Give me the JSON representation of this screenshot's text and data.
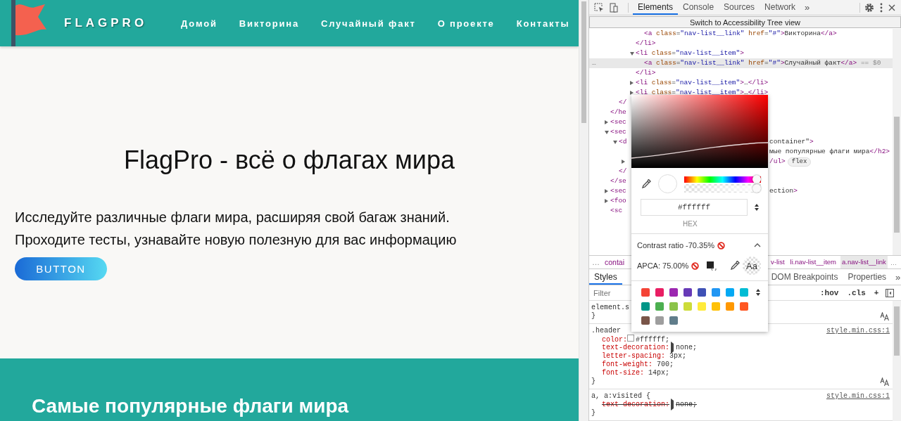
{
  "page": {
    "logo_text": "FLAGPRO",
    "nav": [
      {
        "label": "Домой"
      },
      {
        "label": "Викторина"
      },
      {
        "label": "Случайный факт"
      },
      {
        "label": "О проекте"
      },
      {
        "label": "Контакты"
      }
    ],
    "hero": {
      "title": "FlagPro - всё о флагах мира",
      "lines": [
        "Исследуйте различные флаги мира, расширяя свой багаж знаний.",
        "Проходите тесты, узнавайте новую полезную для вас информацию"
      ],
      "button": "BUTTON"
    },
    "section_title": "Самые популярные флаги мира"
  },
  "devtools": {
    "tabs": [
      {
        "label": "Elements",
        "selected": true
      },
      {
        "label": "Console",
        "selected": false
      },
      {
        "label": "Sources",
        "selected": false
      },
      {
        "label": "Network",
        "selected": false
      }
    ],
    "more_tabs": "»",
    "a11y_button": "Switch to Accessibility Tree view",
    "dom_tree": [
      {
        "children": [
          {
            "children": [
              {
                "children": [
                  {
                    "children": [
                      {
                        "text": "<a class=\"nav-list__link\" href=\"#\">Викторина</a>",
                        "selected": false
                      }
                    ]
                  },
                  {
                    "text": "</li>",
                    "selected": false
                  },
                  {
                    "text": "<li class=\"nav-list__item\">",
                    "expanded": true,
                    "selected": false,
                    "children": [
                      {
                        "text": "<a class=\"nav-list__link\" href=\"#\">Случайный факт</a> == $0",
                        "selected": true,
                        "actions": "…"
                      }
                    ]
                  },
                  {
                    "text": "</li>",
                    "selected": false
                  },
                  {
                    "text": "<li class=\"nav-list__item\">…</li>",
                    "expanded": false,
                    "selected": false
                  },
                  {
                    "text": "<li class=\"nav-list__item\">…</li>",
                    "expanded": false,
                    "selected": false
                  }
                ]
              }
            ]
          },
          {
            "text": "</",
            "selected": false
          }
        ]
      },
      {
        "text": "</he",
        "selected": false
      },
      {
        "text": "<sec",
        "expanded": false,
        "selected": false
      },
      {
        "text": "<sec",
        "expanded": true,
        "selected": false,
        "children": [
          {
            "text": "<d",
            "text_right": "container\">",
            "expanded": true,
            "selected": false,
            "children": [
              {
                "text_right": "мые популярные флаги мира</h2>",
                "selected": false
              },
              {
                "text_right": "/ul>",
                "badge": "flex",
                "expanded": false,
                "selected": false
              }
            ]
          },
          {
            "text": "</",
            "selected": false
          }
        ]
      },
      {
        "text": "</se",
        "selected": false
      },
      {
        "text": "<sec",
        "text_right": "ection>",
        "expanded": false,
        "selected": false
      },
      {
        "text": "<foo",
        "expanded": false,
        "selected": false
      },
      {
        "text": "<sc",
        "selected": false
      }
    ],
    "breadcrumb_more": [
      "…",
      "…"
    ],
    "breadcrumbs": [
      {
        "label": "contai",
        "selected": false
      },
      {
        "label": "v-list",
        "selected": false
      },
      {
        "label": "li.nav-list__item",
        "selected": false
      },
      {
        "label": "a.nav-list__link",
        "selected": true
      }
    ],
    "sub_tabs": [
      {
        "label": "Styles",
        "selected": true
      },
      {
        "label": "DOM Breakpoints",
        "selected": false
      },
      {
        "label": "Properties",
        "selected": false
      }
    ],
    "sub_more": "»",
    "filter": {
      "placeholder": "Filter"
    },
    "toolbar_buttons": [
      ":hov",
      ".cls",
      "+"
    ],
    "rules": [
      {
        "selector": "element.s",
        "close": "}",
        "font_editor": true
      },
      {
        "selector": ".header",
        "source": "style.min.css:1",
        "close": "}",
        "font_editor": true,
        "declarations": [
          {
            "kind": "color",
            "property": "color:",
            "value": "#ffffff;"
          },
          {
            "kind": "expandable",
            "property": "text-decoration:",
            "value": "none;",
            "overridden": false
          },
          {
            "kind": "plain",
            "property": "letter-spacing:",
            "value": "3px;",
            "overridden": false
          },
          {
            "kind": "plain",
            "property": "font-weight:",
            "value": "700;",
            "overridden": false
          },
          {
            "kind": "plain",
            "property": "font-size:",
            "value": "14px;",
            "overridden": false
          }
        ]
      },
      {
        "selector": "a, a:visited {",
        "source": "style.min.css:1",
        "close": "}",
        "font_editor": false,
        "declarations": [
          {
            "kind": "expandable",
            "property": "text-decoration:",
            "value": "none;",
            "overridden": true
          }
        ]
      }
    ],
    "color_picker": {
      "value": "#ffffff",
      "format": "HEX",
      "hue": {
        "level": 1
      },
      "alpha": {
        "level": 1
      },
      "contrast": {
        "text": "Contrast ratio -70.35%",
        "passes": false,
        "expanded": true
      },
      "apca": {
        "text": "APCA: 75.00%",
        "passes": false
      },
      "preview": "Aa",
      "palette": [
        {
          "color": "#f44336"
        },
        {
          "color": "#e91e63"
        },
        {
          "color": "#9c27b0"
        },
        {
          "color": "#673ab7"
        },
        {
          "color": "#3f51b5"
        },
        {
          "color": "#2196f3"
        },
        {
          "color": "#03a9f4"
        },
        {
          "color": "#00bcd4"
        },
        {
          "color": "#009688"
        },
        {
          "color": "#4caf50"
        },
        {
          "color": "#8bc34a"
        },
        {
          "color": "#cddc39"
        },
        {
          "color": "#ffeb3b"
        },
        {
          "color": "#ffc107"
        },
        {
          "color": "#ff9800"
        },
        {
          "color": "#ff5722"
        },
        {
          "color": "#795548"
        },
        {
          "color": "#9e9e9e"
        },
        {
          "color": "#607d8b"
        }
      ]
    }
  }
}
